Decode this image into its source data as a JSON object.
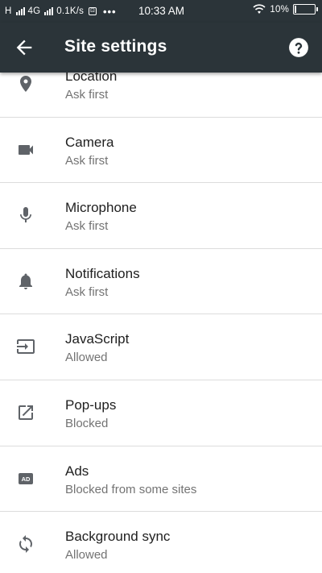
{
  "status_bar": {
    "network_left": "H",
    "network_type": "4G",
    "speed": "0.1K/s",
    "badge": "⊡",
    "dots": "•••",
    "time": "10:33 AM",
    "battery_text": "10%",
    "battery_level": 0.1
  },
  "app_bar": {
    "title": "Site settings",
    "back_icon": "arrow-back-icon",
    "help_icon": "help-icon"
  },
  "settings": [
    {
      "title": "Location",
      "subtitle": "Ask first",
      "icon": "location-pin-icon"
    },
    {
      "title": "Camera",
      "subtitle": "Ask first",
      "icon": "camera-icon"
    },
    {
      "title": "Microphone",
      "subtitle": "Ask first",
      "icon": "microphone-icon"
    },
    {
      "title": "Notifications",
      "subtitle": "Ask first",
      "icon": "bell-icon"
    },
    {
      "title": "JavaScript",
      "subtitle": "Allowed",
      "icon": "javascript-icon"
    },
    {
      "title": "Pop-ups",
      "subtitle": "Blocked",
      "icon": "popup-icon"
    },
    {
      "title": "Ads",
      "subtitle": "Blocked from some sites",
      "icon": "ads-icon"
    },
    {
      "title": "Background sync",
      "subtitle": "Allowed",
      "icon": "sync-icon"
    }
  ]
}
